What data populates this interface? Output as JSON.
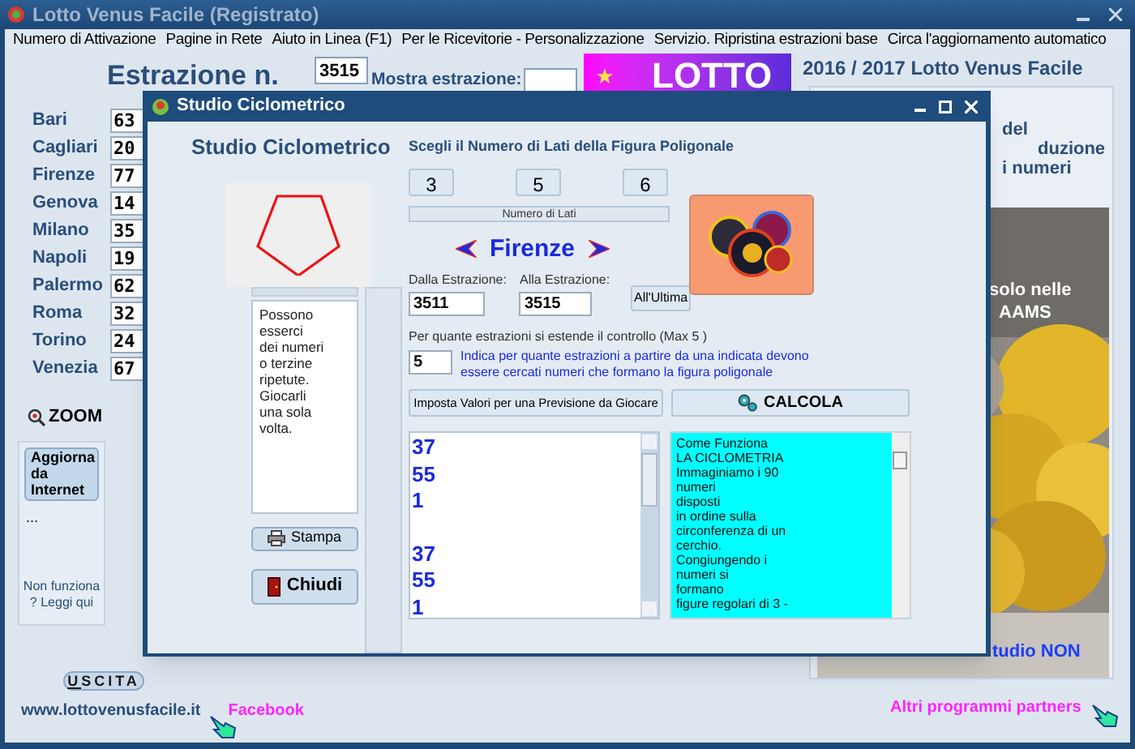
{
  "window": {
    "title": "Lotto Venus Facile (Registrato)"
  },
  "menu": [
    "Numero di Attivazione",
    "Pagine in Rete",
    "Aiuto in Linea (F1)",
    "Per le Ricevitorie - Personalizzazione",
    "Servizio. Ripristina estrazioni base",
    "Circa l'aggiornamento automatico"
  ],
  "draw_number": {
    "label": "Estrazione n.",
    "value": "3515"
  },
  "show_draw": {
    "label": "Mostra estrazione:"
  },
  "banner": {
    "text": "LOTTO"
  },
  "cities": [
    {
      "name": "Bari",
      "value": "63"
    },
    {
      "name": "Cagliari",
      "value": "20"
    },
    {
      "name": "Firenze",
      "value": "77"
    },
    {
      "name": "Genova",
      "value": "14"
    },
    {
      "name": "Milano",
      "value": "35"
    },
    {
      "name": "Napoli",
      "value": "19"
    },
    {
      "name": "Palermo",
      "value": "62"
    },
    {
      "name": "Roma",
      "value": "32"
    },
    {
      "name": "Torino",
      "value": "24"
    },
    {
      "name": "Venezia",
      "value": "67"
    }
  ],
  "zoom": {
    "label": "ZOOM"
  },
  "update": {
    "button": "Aggiorna da Internet",
    "status": "...",
    "help": "Non funziona ? Leggi qui"
  },
  "exit_button": "USCITA",
  "website": "www.lottovenusfacile.it",
  "facebook": "Facebook",
  "side_panel": {
    "title": "2016 / 2017 Lotto Venus Facile",
    "fragments": [
      "del",
      "duzione",
      "i numeri"
    ],
    "photo_fragments": [
      "solo nelle",
      "AAMS"
    ],
    "bottom_fragment": "tudio NON"
  },
  "partners": "Altri programmi partners",
  "dialog": {
    "title": "Studio Ciclometrico",
    "heading": "Studio Ciclometrico",
    "note": [
      "Possono",
      "esserci",
      "dei numeri",
      "o terzine",
      "ripetute.",
      "Giocarli",
      "una sola",
      "volta."
    ],
    "print_button": "Stampa",
    "close_button": "Chiudi",
    "sides_prompt": "Scegli il Numero di Lati della Figura Poligonale",
    "sides_buttons": [
      "3",
      "5",
      "6"
    ],
    "sides_label": "Numero di Lati",
    "wheel": "Firenze",
    "from": {
      "label": "Dalla Estrazione:",
      "value": "3511"
    },
    "to": {
      "label": "Alla Estrazione:",
      "value": "3515"
    },
    "last_button": "All'Ultima",
    "span": {
      "label": "Per quante estrazioni si estende il controllo (Max 5 )",
      "value": "5",
      "hint": "Indica per quante estrazioni a partire da una indicata devono essere cercati numeri che formano la figura poligonale"
    },
    "forecast_button": "Imposta Valori per una Previsione da Giocare",
    "calc_button": "CALCOLA",
    "results": [
      [
        "37",
        "55",
        "1"
      ],
      [
        "37",
        "55",
        "1"
      ]
    ],
    "help_lines": [
      "Come Funziona",
      "LA CICLOMETRIA",
      "Immaginiamo i 90",
      "numeri",
      "disposti",
      "in ordine sulla",
      "circonferenza di un",
      "cerchio.",
      "Congiungendo i",
      "numeri si",
      "formano",
      "figure regolari di 3 -"
    ]
  }
}
